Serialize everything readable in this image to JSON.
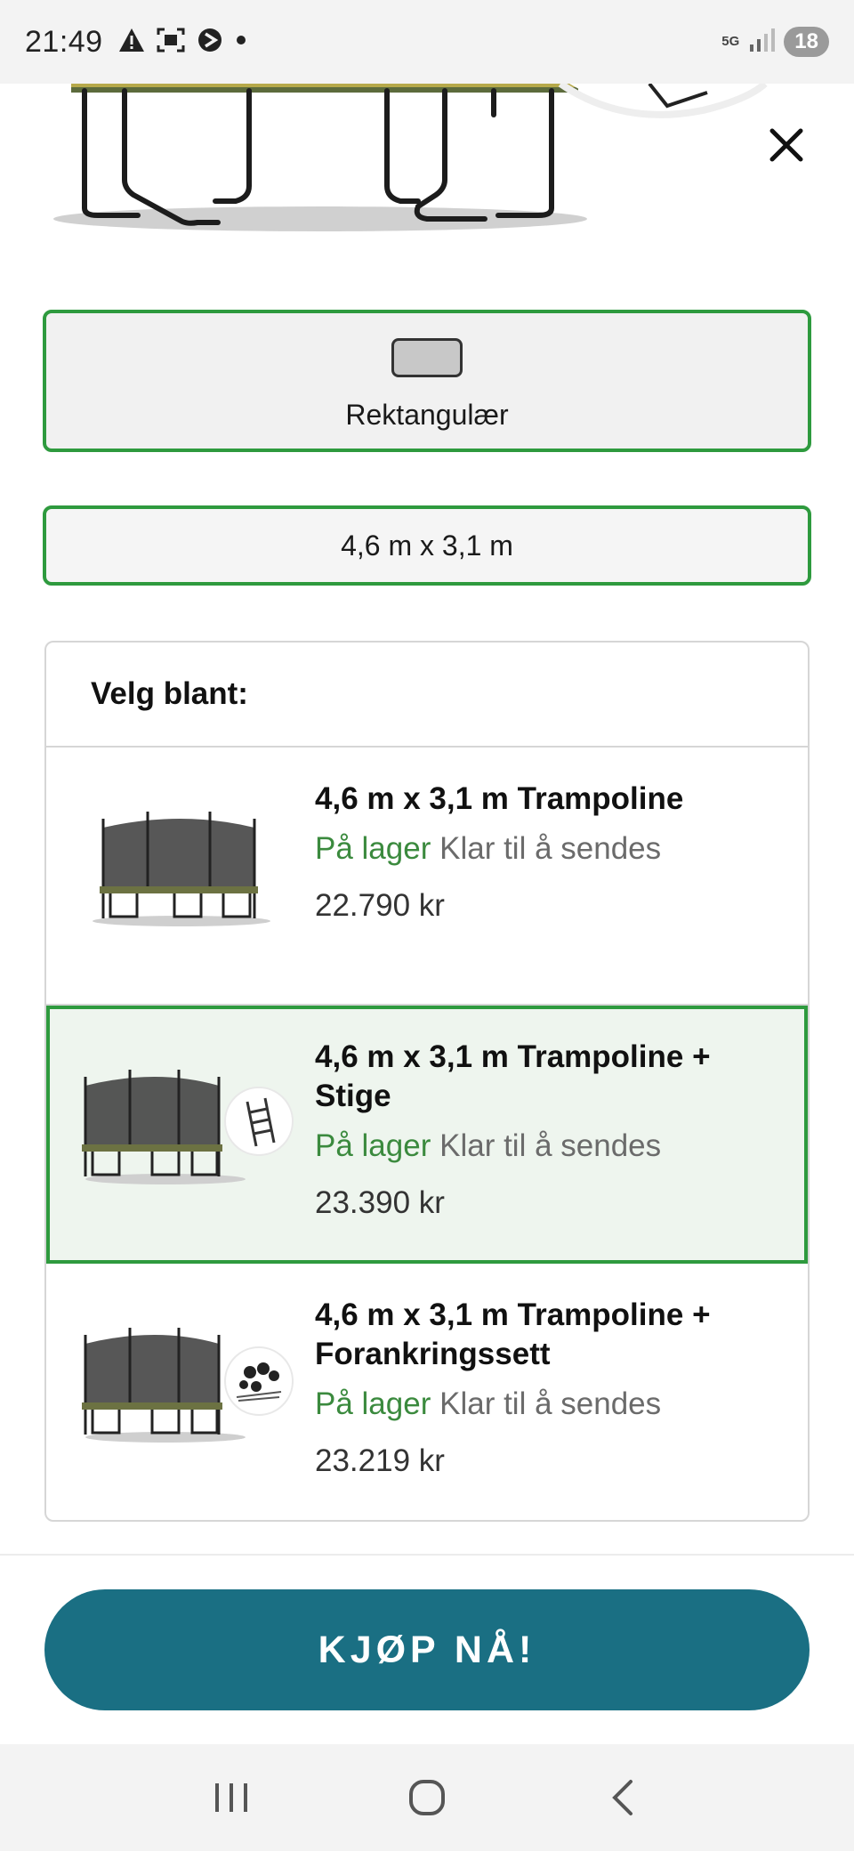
{
  "status_bar": {
    "time": "21:49",
    "network": "5G",
    "notification_count": "18"
  },
  "options": {
    "shape_label": "Rektangulær",
    "size_label": "4,6 m x 3,1 m"
  },
  "list": {
    "header": "Velg blant:",
    "items": [
      {
        "title": "4,6 m x 3,1 m Trampoline",
        "stock_status": "På lager",
        "stock_note": "Klar til å sendes",
        "price": "22.790 kr",
        "selected": false
      },
      {
        "title": "4,6 m x 3,1 m Trampoline + Stige",
        "stock_status": "På lager",
        "stock_note": "Klar til å sendes",
        "price": "23.390 kr",
        "selected": true
      },
      {
        "title": "4,6 m x 3,1 m Trampoline + Forankringssett",
        "stock_status": "På lager",
        "stock_note": "Klar til å sendes",
        "price": "23.219 kr",
        "selected": false
      }
    ]
  },
  "buy_button": {
    "label": "KJØP NÅ!"
  },
  "colors": {
    "accent_green": "#2e9a3e",
    "stock_green": "#3b8a3e",
    "buy_button": "#1a6f83",
    "selected_bg": "#eef5ee"
  },
  "icons": [
    "warning-icon",
    "screenshot-icon",
    "cast-icon",
    "dot-icon",
    "signal-icon",
    "close-icon",
    "recent-apps-icon",
    "home-icon",
    "back-icon"
  ]
}
